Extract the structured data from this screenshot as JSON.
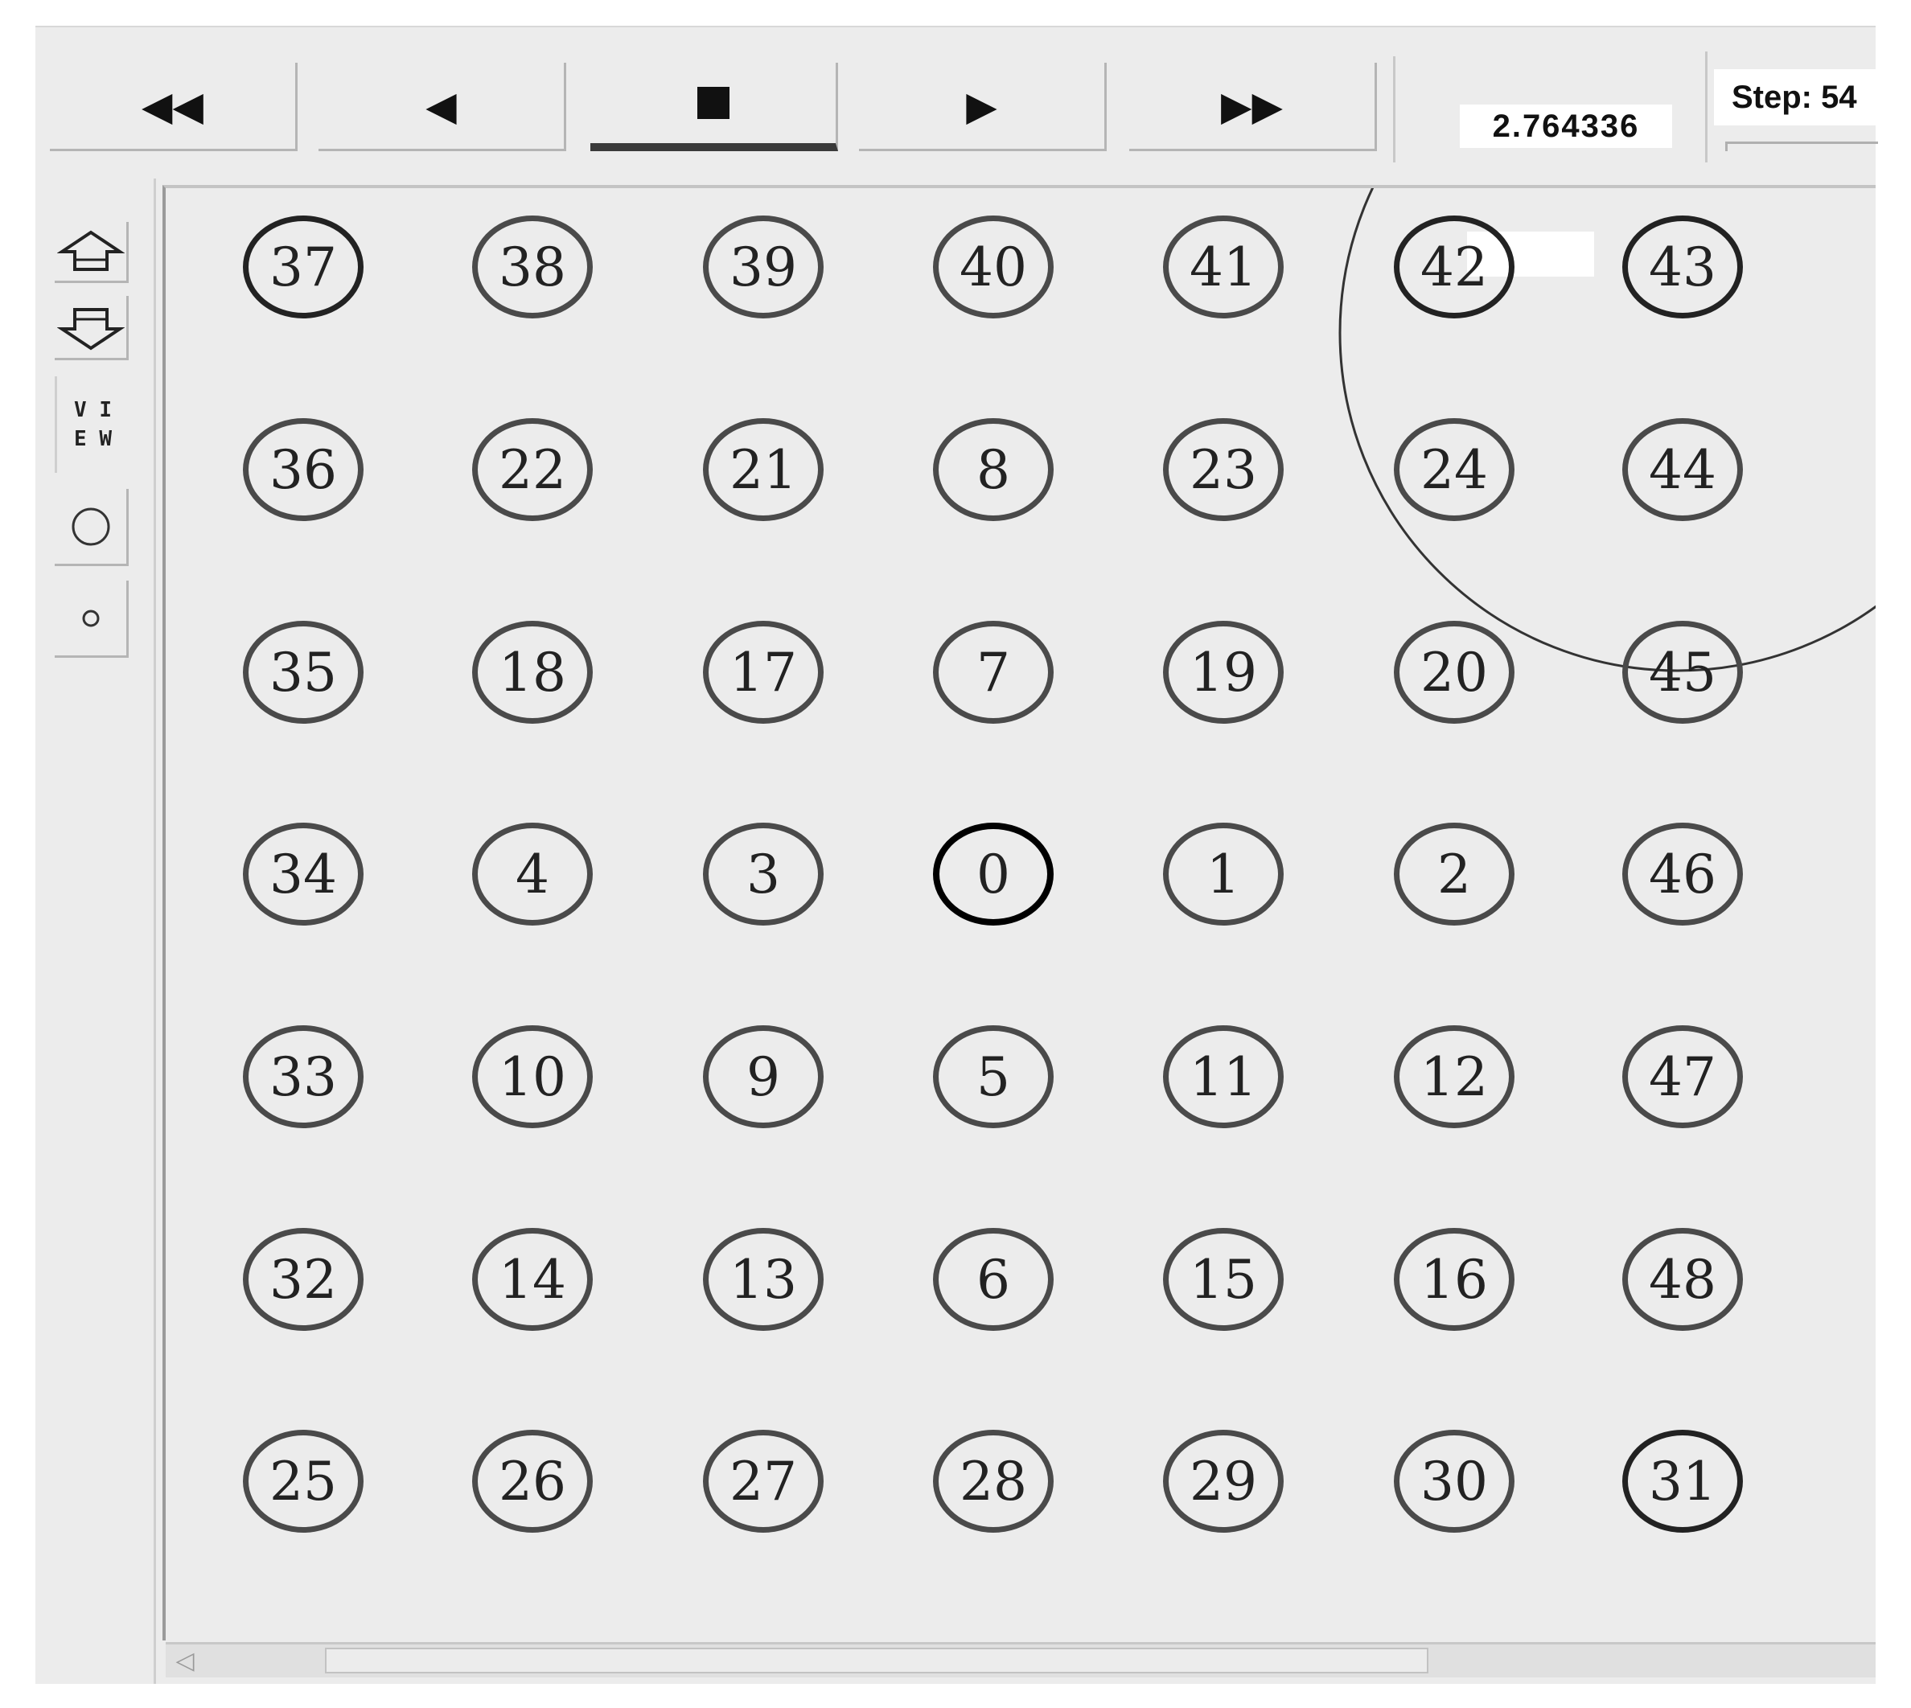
{
  "toolbar": {
    "buttons": [
      {
        "name": "rewind-button",
        "icon": "fast-backward-icon",
        "glyph": "◀◀"
      },
      {
        "name": "step-back-button",
        "icon": "step-back-icon",
        "glyph": "◀"
      },
      {
        "name": "stop-button",
        "icon": "stop-icon",
        "glyph": "■",
        "active": true
      },
      {
        "name": "play-button",
        "icon": "play-icon",
        "glyph": "▶"
      },
      {
        "name": "fast-forward-button",
        "icon": "fast-forward-icon",
        "glyph": "▶▶"
      }
    ],
    "sim_time": "2.764336",
    "step_label": "Step: 54"
  },
  "side": {
    "zoom_in_icon": "zoom-in-arrow-icon",
    "zoom_out_icon": "zoom-out-arrow-icon",
    "view_label_line1": "V I",
    "view_label_line2": "E W",
    "large_node_icon": "large-circle-icon",
    "small_node_icon": "small-circle-icon"
  },
  "network": {
    "node_grid": [
      [
        "37",
        "38",
        "39",
        "40",
        "41",
        "42",
        "43"
      ],
      [
        "36",
        "22",
        "21",
        "8",
        "23",
        "24",
        "44"
      ],
      [
        "35",
        "18",
        "17",
        "7",
        "19",
        "20",
        "45"
      ],
      [
        "34",
        "4",
        "3",
        "0",
        "1",
        "2",
        "46"
      ],
      [
        "33",
        "10",
        "9",
        "5",
        "11",
        "12",
        "47"
      ],
      [
        "32",
        "14",
        "13",
        "6",
        "15",
        "16",
        "48"
      ],
      [
        "25",
        "26",
        "27",
        "28",
        "29",
        "30",
        "31"
      ]
    ],
    "highlighted_node": "0",
    "range_circle_node": "42",
    "colors": {
      "node_border": "#4a4a4a",
      "current_node_border": "#000000",
      "background": "#ececec"
    }
  }
}
